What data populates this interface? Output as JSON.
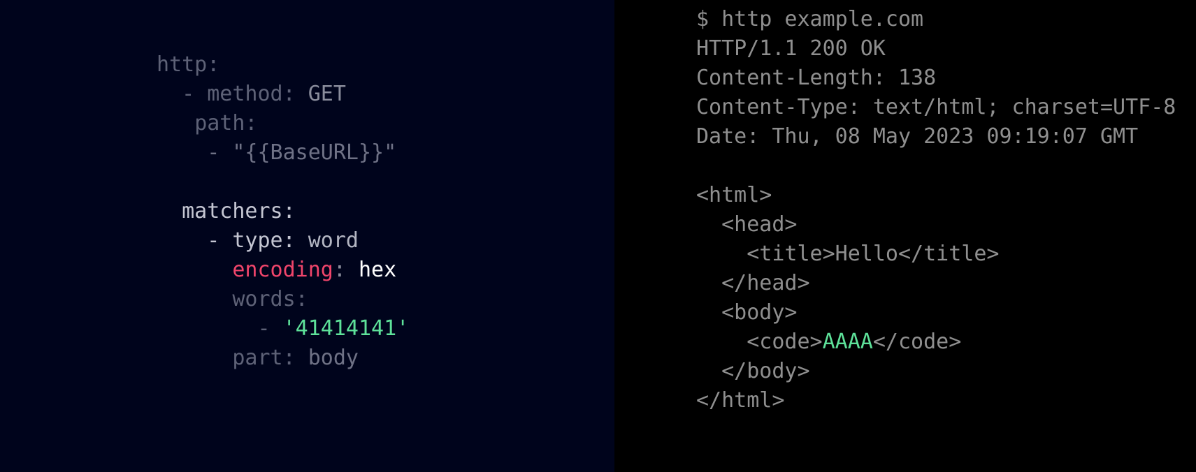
{
  "colors": {
    "left_background": "#00041c",
    "right_background": "#000000",
    "dim_key": "#5e6277",
    "dim_value": "#8a8d9c",
    "bright_key": "#c4c6d2",
    "bright_value": "#b3b6c2",
    "encoding_key": "#f0456b",
    "encoding_value": "#ffffff",
    "match_green": "#5ee29a",
    "terminal_text": "#8f8f8f"
  },
  "template": {
    "lines": [
      {
        "indent": "",
        "tokens": [
          {
            "text": "http:",
            "color": "#5e6277"
          }
        ]
      },
      {
        "indent": "  ",
        "tokens": [
          {
            "text": "- method: ",
            "color": "#5e6277"
          },
          {
            "text": "GET",
            "color": "#8a8d9c"
          }
        ]
      },
      {
        "indent": "   ",
        "tokens": [
          {
            "text": "path:",
            "color": "#5e6277"
          }
        ]
      },
      {
        "indent": "    ",
        "tokens": [
          {
            "text": "- \"{{BaseURL}}\"",
            "color": "#6f7286"
          }
        ]
      },
      {
        "indent": "",
        "tokens": []
      },
      {
        "indent": "  ",
        "tokens": [
          {
            "text": "matchers:",
            "color": "#c4c6d2"
          }
        ]
      },
      {
        "indent": "    ",
        "tokens": [
          {
            "text": "- type: ",
            "color": "#c4c6d2"
          },
          {
            "text": "word",
            "color": "#b3b6c2"
          }
        ]
      },
      {
        "indent": "      ",
        "tokens": [
          {
            "text": "encoding",
            "color": "#f0456b"
          },
          {
            "text": ": ",
            "color": "#8a8d9c"
          },
          {
            "text": "hex",
            "color": "#ffffff"
          }
        ]
      },
      {
        "indent": "      ",
        "tokens": [
          {
            "text": "words:",
            "color": "#5e6277"
          }
        ]
      },
      {
        "indent": "        ",
        "tokens": [
          {
            "text": "- ",
            "color": "#5e6277"
          },
          {
            "text": "'41414141'",
            "color": "#5ee29a"
          }
        ]
      },
      {
        "indent": "      ",
        "tokens": [
          {
            "text": "part: ",
            "color": "#5e6277"
          },
          {
            "text": "body",
            "color": "#6f7286"
          }
        ]
      }
    ]
  },
  "terminal": {
    "lines": [
      {
        "indent": "",
        "tokens": [
          {
            "text": "$ http example.com",
            "color": "#8f8f8f"
          }
        ]
      },
      {
        "indent": "",
        "tokens": [
          {
            "text": "HTTP/1.1 200 OK",
            "color": "#8f8f8f"
          }
        ]
      },
      {
        "indent": "",
        "tokens": [
          {
            "text": "Content-Length: 138",
            "color": "#8f8f8f"
          }
        ]
      },
      {
        "indent": "",
        "tokens": [
          {
            "text": "Content-Type: text/html; charset=UTF-8",
            "color": "#8f8f8f"
          }
        ]
      },
      {
        "indent": "",
        "tokens": [
          {
            "text": "Date: Thu, 08 May 2023 09:19:07 GMT",
            "color": "#8f8f8f"
          }
        ]
      },
      {
        "indent": "",
        "tokens": []
      },
      {
        "indent": "",
        "tokens": [
          {
            "text": "<html>",
            "color": "#8f8f8f"
          }
        ]
      },
      {
        "indent": "  ",
        "tokens": [
          {
            "text": "<head>",
            "color": "#8f8f8f"
          }
        ]
      },
      {
        "indent": "    ",
        "tokens": [
          {
            "text": "<title>Hello</title>",
            "color": "#8f8f8f"
          }
        ]
      },
      {
        "indent": "  ",
        "tokens": [
          {
            "text": "</head>",
            "color": "#8f8f8f"
          }
        ]
      },
      {
        "indent": "  ",
        "tokens": [
          {
            "text": "<body>",
            "color": "#8f8f8f"
          }
        ]
      },
      {
        "indent": "    ",
        "tokens": [
          {
            "text": "<code>",
            "color": "#8f8f8f"
          },
          {
            "text": "AAAA",
            "color": "#5ee29a"
          },
          {
            "text": "</code>",
            "color": "#8f8f8f"
          }
        ]
      },
      {
        "indent": "  ",
        "tokens": [
          {
            "text": "</body>",
            "color": "#8f8f8f"
          }
        ]
      },
      {
        "indent": "",
        "tokens": [
          {
            "text": "</html>",
            "color": "#8f8f8f"
          }
        ]
      }
    ]
  }
}
